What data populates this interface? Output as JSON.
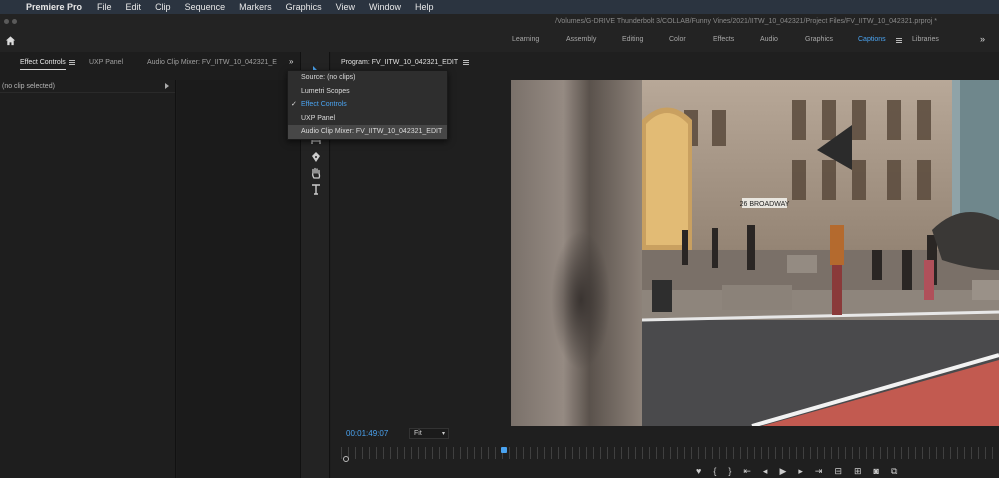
{
  "menubar": {
    "app_name": "Premiere Pro",
    "items": [
      "File",
      "Edit",
      "Clip",
      "Sequence",
      "Markers",
      "Graphics",
      "View",
      "Window",
      "Help"
    ]
  },
  "titlebar": {
    "path": "/Volumes/G-DRIVE Thunderbolt 3/COLLAB/Funny Vines/2021/IITW_10_042321/Project Files/FV_IITW_10_042321.prproj *"
  },
  "workspaces": {
    "items": [
      "Learning",
      "Assembly",
      "Editing",
      "Color",
      "Effects",
      "Audio",
      "Graphics",
      "Captions",
      "Libraries"
    ],
    "active": "Captions"
  },
  "left_tabs": {
    "effect_controls": "Effect Controls",
    "uxp_panel": "UXP Panel",
    "audio_clip_mixer": "Audio Clip Mixer: FV_IITW_10_042321_E"
  },
  "left_panel": {
    "no_clip": "(no clip selected)"
  },
  "dropdown": {
    "items": [
      {
        "label": "Source: (no clips)",
        "checked": false,
        "hover": false
      },
      {
        "label": "Lumetri Scopes",
        "checked": false,
        "hover": false
      },
      {
        "label": "Effect Controls",
        "checked": true,
        "hover": false
      },
      {
        "label": "UXP Panel",
        "checked": false,
        "hover": false
      },
      {
        "label": "Audio Clip Mixer: FV_IITW_10_042321_EDIT",
        "checked": false,
        "hover": true
      }
    ]
  },
  "program": {
    "title": "Program: FV_IITW_10_042321_EDIT",
    "timecode": "00:01:49:07",
    "fit": "Fit",
    "street_sign": "26 BROADWAY"
  },
  "colors": {
    "accent": "#4aa3f0",
    "menubar_bg": "#2b3440"
  }
}
